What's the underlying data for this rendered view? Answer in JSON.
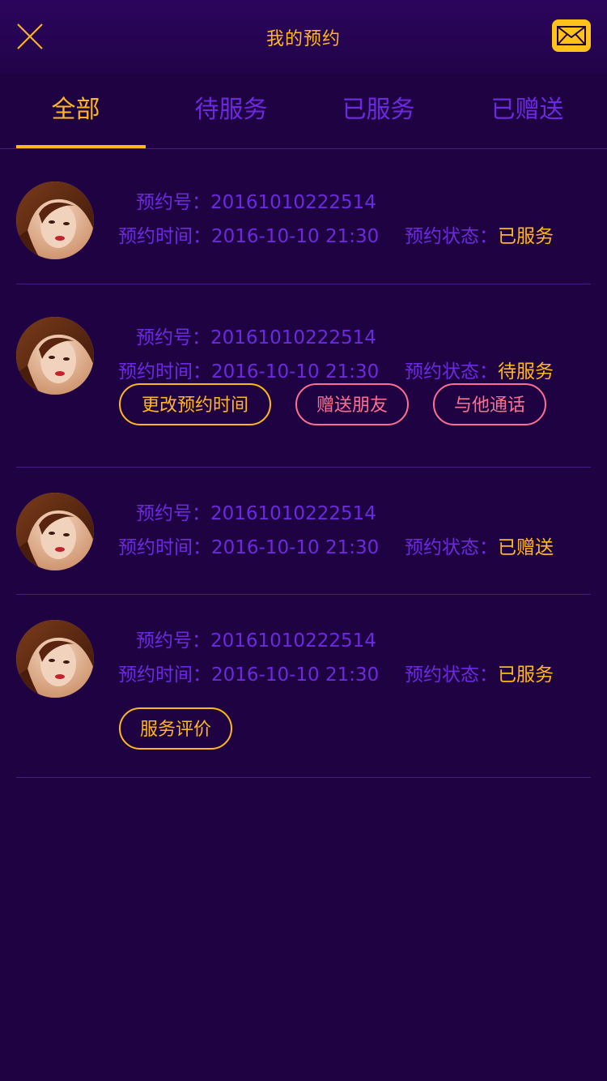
{
  "header": {
    "title": "我的预约",
    "close_icon": "close-icon",
    "mail_icon": "mail-icon"
  },
  "tabs": [
    {
      "label": "全部",
      "active": true
    },
    {
      "label": "待服务",
      "active": false
    },
    {
      "label": "已服务",
      "active": false
    },
    {
      "label": "已赠送",
      "active": false
    }
  ],
  "labels": {
    "booking_no": "预约号：",
    "booking_time": "预约时间：",
    "booking_status": "预约状态："
  },
  "items": [
    {
      "number": "20161010222514",
      "time": "2016-10-10 21:30",
      "status": "已服务",
      "actions": []
    },
    {
      "number": "20161010222514",
      "time": "2016-10-10 21:30",
      "status": "待服务",
      "actions": [
        "更改预约时间",
        "赠送朋友",
        "与他通话"
      ]
    },
    {
      "number": "20161010222514",
      "time": "2016-10-10 21:30",
      "status": "已赠送",
      "actions": []
    },
    {
      "number": "20161010222514",
      "time": "2016-10-10 21:30",
      "status": "已服务",
      "actions": [
        "服务评价"
      ]
    }
  ],
  "colors": {
    "background": "#1f0242",
    "accent": "#ffb81c",
    "text_purple": "#6c2ae0",
    "pink": "#ff6f91",
    "divider": "#4a1a8a"
  }
}
